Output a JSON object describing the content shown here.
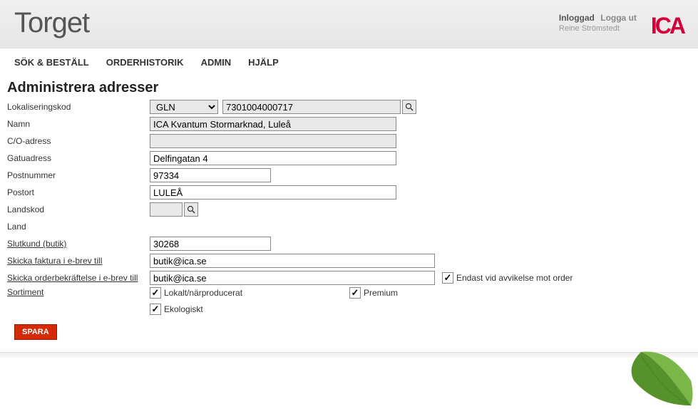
{
  "header": {
    "brand": "Torget",
    "auth_status": "Inloggad",
    "logout": "Logga ut",
    "username": "Reine Strömstedt",
    "logo_text": "ICA"
  },
  "nav": {
    "items": [
      {
        "label": "SÖK & BESTÄLL"
      },
      {
        "label": "ORDERHISTORIK"
      },
      {
        "label": "ADMIN"
      },
      {
        "label": "HJÄLP"
      }
    ]
  },
  "page_title": "Administrera adresser",
  "form": {
    "labels": {
      "lokaliseringskod": "Lokaliseringskod",
      "namn": "Namn",
      "coadress": "C/O-adress",
      "gatuadress": "Gatuadress",
      "postnummer": "Postnummer",
      "postort": "Postort",
      "landskod": "Landskod",
      "land": "Land",
      "slutkund": "Slutkund (butik)",
      "faktura": "Skicka faktura i e-brev till",
      "orderbekraftelse": "Skicka orderbekräftelse i e-brev till",
      "sortiment": "Sortiment"
    },
    "values": {
      "lok_type": "GLN",
      "lok_code": "7301004000717",
      "namn": "ICA Kvantum Stormarknad, Luleå",
      "coadress": "",
      "gatuadress": "Delfingatan 4",
      "postnummer": "97334",
      "postort": "LULEÅ",
      "landskod": "",
      "land": "",
      "slutkund": "30268",
      "faktura_email": "butik@ica.se",
      "order_email": "butik@ica.se"
    },
    "checkboxes": {
      "endast_avvikelse": {
        "label": "Endast vid avvikelse mot order",
        "checked": true
      },
      "lokalt": {
        "label": "Lokalt/närproducerat",
        "checked": true
      },
      "premium": {
        "label": "Premium",
        "checked": true
      },
      "ekologiskt": {
        "label": "Ekologiskt",
        "checked": true
      }
    },
    "spara": "SPARA"
  }
}
